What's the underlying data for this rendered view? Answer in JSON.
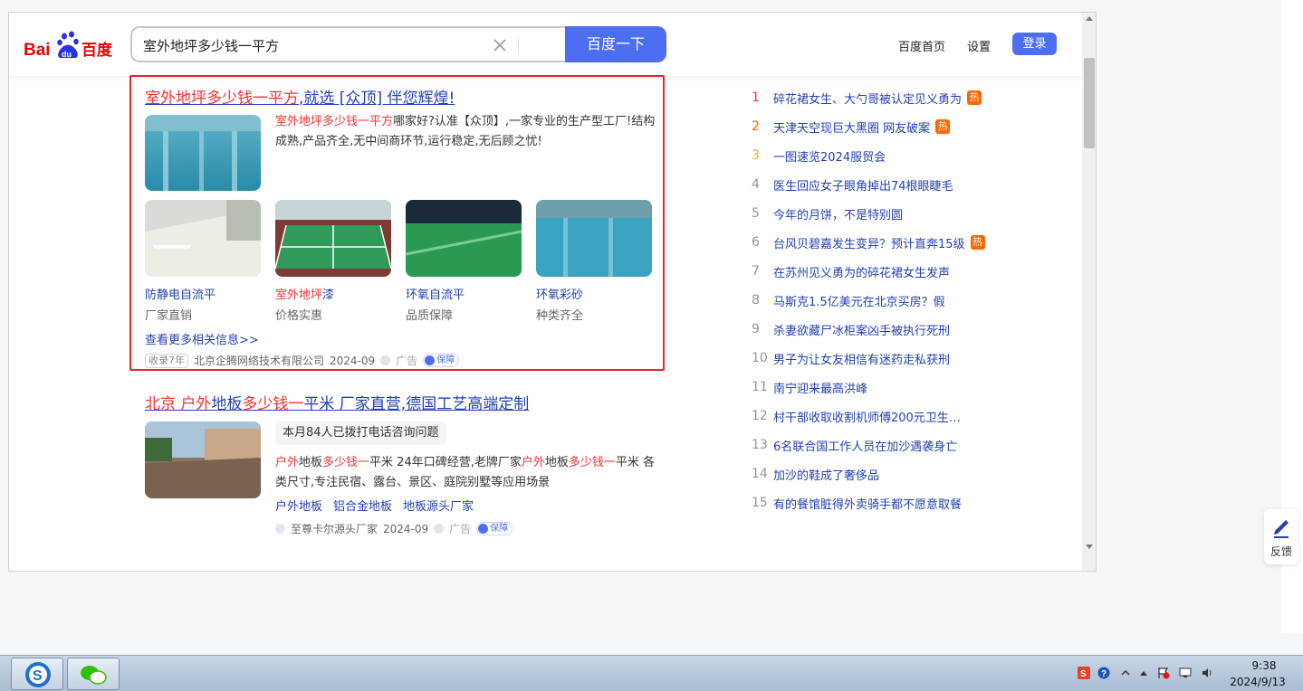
{
  "colors": {
    "accent": "#4e6ef2",
    "highlight_red": "#f73131",
    "link_blue": "#2440b3",
    "box_red": "#e8262a",
    "hot_orange": "#ff6600"
  },
  "logo": {
    "text": "百度"
  },
  "search": {
    "value": "室外地坪多少钱一平方",
    "button_label": "百度一下"
  },
  "header_nav": {
    "home": "百度首页",
    "settings": "设置",
    "login": "登录"
  },
  "ad1": {
    "title_hl": "室外地坪多少钱一平方",
    "title_rest": ",就选 [众顶] 伴您辉煌!",
    "desc_hl": "室外地坪多少钱一平方",
    "desc_rest": "哪家好?认准【众顶】,一家专业的生产型工厂!结构成熟,产品齐全,无中间商环节,运行稳定,无后顾之忧!",
    "subitems": [
      {
        "title": "防静电自流平",
        "note": "厂家直销"
      },
      {
        "title_hl": "室外地坪",
        "title_rest": "漆",
        "note": "价格实惠"
      },
      {
        "title": "环氧自流平",
        "note": "品质保障"
      },
      {
        "title": "环氧彩砂",
        "note": "种类齐全"
      }
    ],
    "more_link": "查看更多相关信息>>",
    "meta": {
      "age": "收录7年",
      "company": "北京企腾网络技术有限公司",
      "date": "2024-09",
      "ad": "广告",
      "guarantee": "保障"
    }
  },
  "ad2": {
    "title_p1": "北京 ",
    "title_hl1": "户外",
    "title_p2": "地板",
    "title_hl2": "多少钱一",
    "title_p3": "平米 厂家直营,德国工艺高端定制",
    "callout": "本月84人已拨打电话咨询问题",
    "desc": [
      {
        "t": "户外",
        "hl": true
      },
      {
        "t": "地板",
        "hl": false
      },
      {
        "t": "多少钱一",
        "hl": true
      },
      {
        "t": "平米 24年口碑经营,老牌厂家",
        "hl": false
      },
      {
        "t": "户外",
        "hl": true
      },
      {
        "t": "地板",
        "hl": false
      },
      {
        "t": "多少钱一",
        "hl": true
      },
      {
        "t": "平米 各类尺寸,专注民宿、露台、景区、庭院别墅等应用场景",
        "hl": false
      }
    ],
    "tags": {
      "t1_hl": "户外",
      "t1_rest": "地板",
      "t2": "铝合金地板",
      "t3": "地板源头厂家"
    },
    "meta": {
      "company": "至尊卡尔源头厂家",
      "date": "2024-09",
      "ad": "广告",
      "guarantee": "保障"
    }
  },
  "hot_list": [
    {
      "rank": "1",
      "text": "碎花裙女生、大勺哥被认定见义勇为",
      "badge": "热"
    },
    {
      "rank": "2",
      "text": "天津天空现巨大黑圈 网友破案",
      "badge": "热"
    },
    {
      "rank": "3",
      "text": "一图速览2024服贸会",
      "badge": ""
    },
    {
      "rank": "4",
      "text": "医生回应女子眼角掉出74根眼睫毛",
      "badge": ""
    },
    {
      "rank": "5",
      "text": "今年的月饼，不是特别圆",
      "badge": ""
    },
    {
      "rank": "6",
      "text": "台风贝碧嘉发生变异？预计直奔15级",
      "badge": "热"
    },
    {
      "rank": "7",
      "text": "在苏州见义勇为的碎花裙女生发声",
      "badge": ""
    },
    {
      "rank": "8",
      "text": "马斯克1.5亿美元在北京买房？假",
      "badge": ""
    },
    {
      "rank": "9",
      "text": "杀妻欲藏尸冰柜案凶手被执行死刑",
      "badge": ""
    },
    {
      "rank": "10",
      "text": "男子为让女友相信有迷药走私获刑",
      "badge": ""
    },
    {
      "rank": "11",
      "text": "南宁迎来最高洪峰",
      "badge": ""
    },
    {
      "rank": "12",
      "text": "村干部收取收割机师傅200元卫生…",
      "badge": ""
    },
    {
      "rank": "13",
      "text": "6名联合国工作人员在加沙遇袭身亡",
      "badge": ""
    },
    {
      "rank": "14",
      "text": "加沙的鞋成了奢侈品",
      "badge": ""
    },
    {
      "rank": "15",
      "text": "有的餐馆脏得外卖骑手都不愿意取餐",
      "badge": ""
    }
  ],
  "feedback": {
    "label": "反馈"
  },
  "taskbar": {
    "time": "9:38",
    "date": "2024/9/13"
  }
}
